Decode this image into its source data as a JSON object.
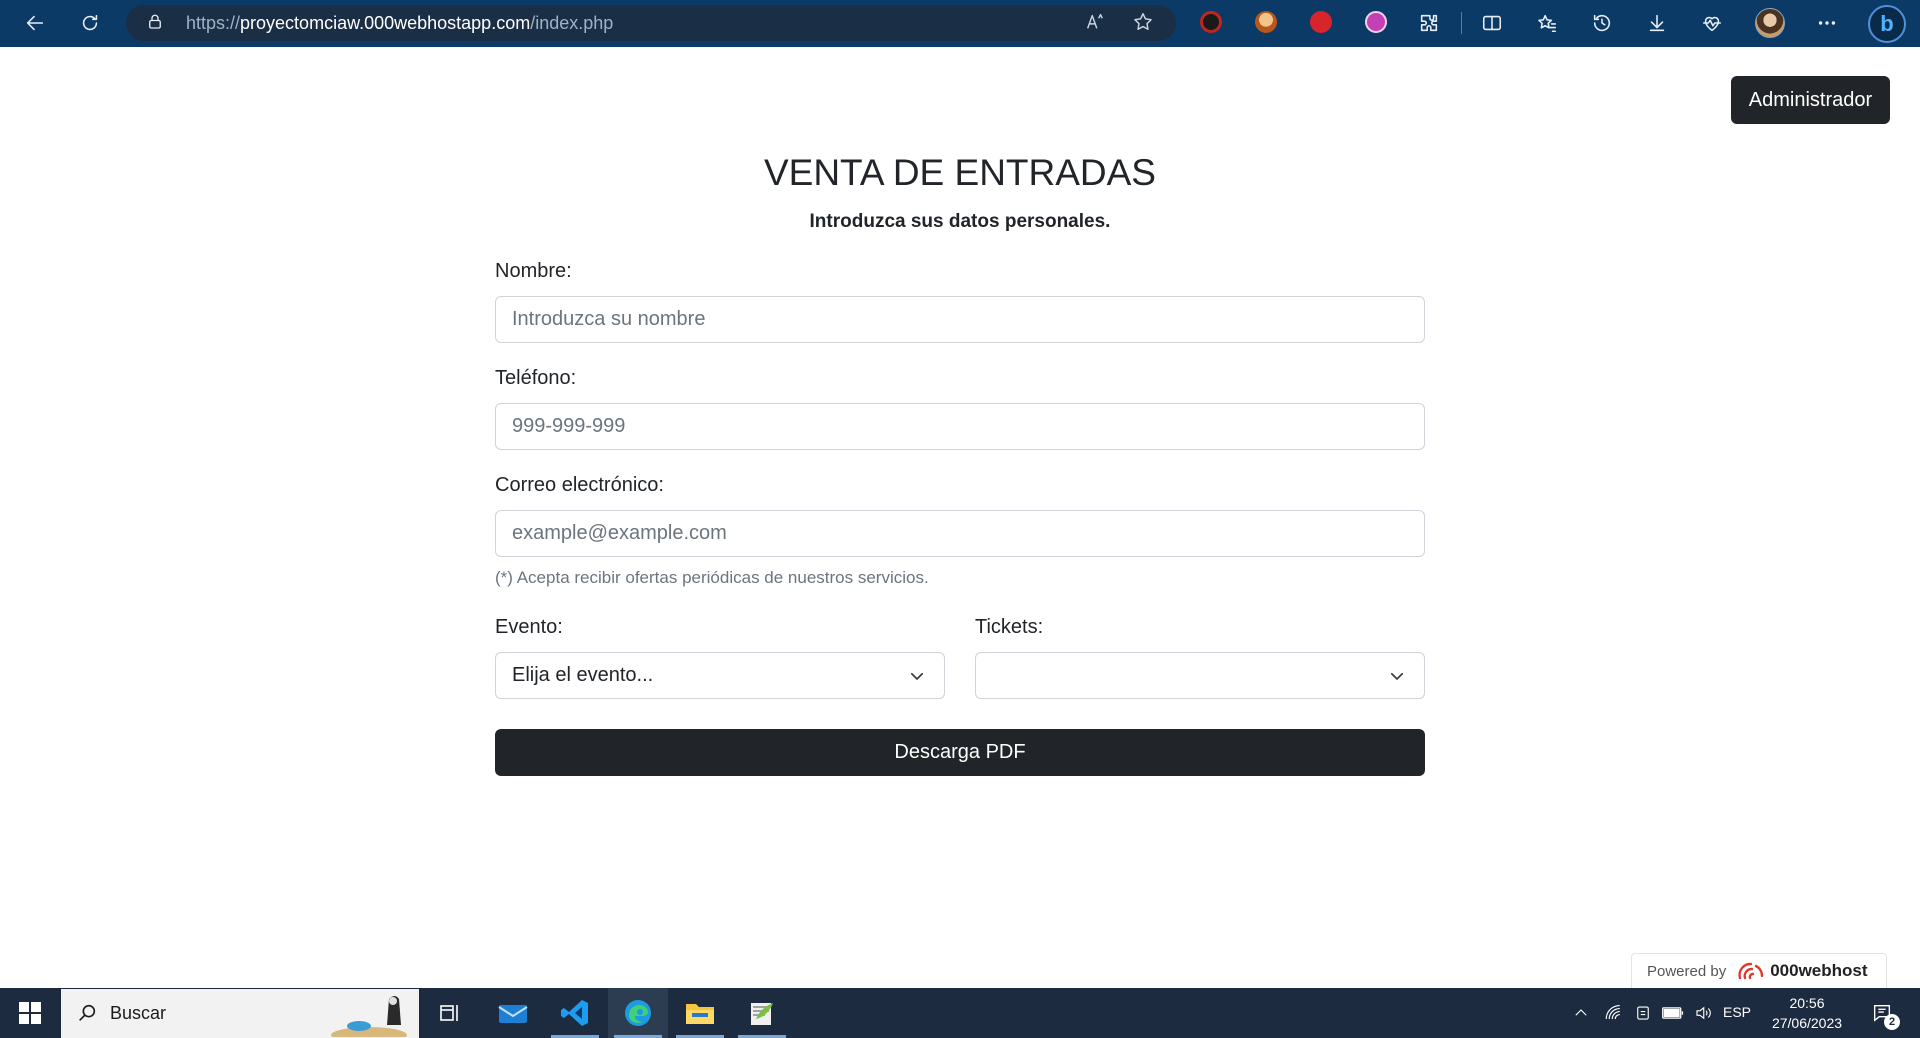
{
  "browser": {
    "url_scheme": "https://",
    "url_host": "proyectomciaw.000webhostapp.com",
    "url_path": "/index.php",
    "icons": [
      "back-icon",
      "refresh-icon",
      "lock-icon",
      "read-aloud-icon",
      "favorite-star-icon",
      "extensions-icon",
      "split-screen-icon",
      "favorites-icon",
      "history-icon",
      "downloads-icon",
      "browser-essentials-icon",
      "more-icon",
      "bing-icon"
    ]
  },
  "header": {
    "admin_button": "Administrador"
  },
  "form": {
    "title": "VENTA DE ENTRADAS",
    "subtitle": "Introduzca sus datos personales.",
    "nombre_label": "Nombre:",
    "nombre_placeholder": "Introduzca su nombre",
    "telefono_label": "Teléfono:",
    "telefono_placeholder": "999-999-999",
    "correo_label": "Correo electrónico:",
    "correo_placeholder": "example@example.com",
    "correo_hint": "(*) Acepta recibir ofertas periódicas de nuestros servicios.",
    "evento_label": "Evento:",
    "evento_selected": "Elija el evento...",
    "tickets_label": "Tickets:",
    "tickets_selected": "",
    "submit": "Descarga PDF"
  },
  "footer_badge": {
    "prefix": "Powered by",
    "brand": "000webhost"
  },
  "taskbar": {
    "search_placeholder": "Buscar",
    "apps": [
      "task-view-icon",
      "mail-icon",
      "vscode-icon",
      "edge-icon",
      "file-explorer-icon",
      "notepad-plus-icon"
    ],
    "language": "ESP",
    "time": "20:56",
    "date": "27/06/2023",
    "notification_count": "2"
  },
  "colors": {
    "browser_bar": "#0b3a66",
    "dark_button": "#212529",
    "taskbar": "#1c2b3f"
  }
}
